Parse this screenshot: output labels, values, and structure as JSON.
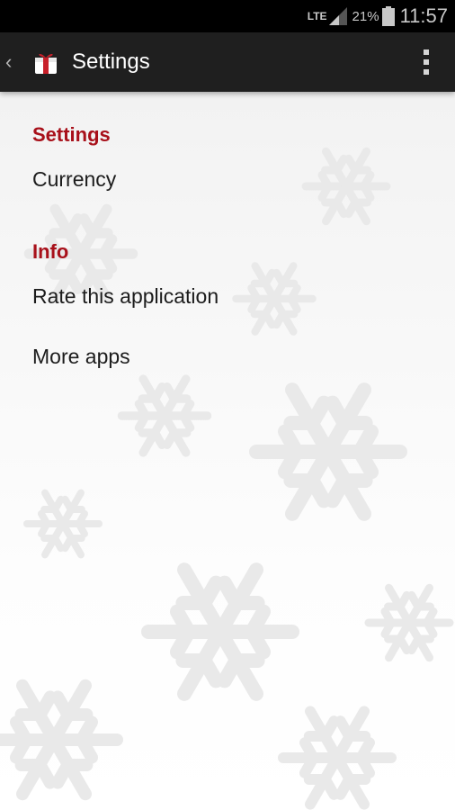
{
  "status_bar": {
    "network": "LTE",
    "battery": "21%",
    "time": "11:57"
  },
  "action_bar": {
    "title": "Settings"
  },
  "sections": [
    {
      "header": "Settings",
      "items": [
        "Currency"
      ]
    },
    {
      "header": "Info",
      "items": [
        "Rate this application",
        "More apps"
      ]
    }
  ],
  "colors": {
    "section_header": "#a8101a",
    "action_bar": "#1f1f1f",
    "status_bar": "#000000"
  },
  "icons": [
    "back-chevron-icon",
    "gift-box-icon",
    "overflow-menu-icon",
    "signal-icon",
    "battery-icon"
  ]
}
